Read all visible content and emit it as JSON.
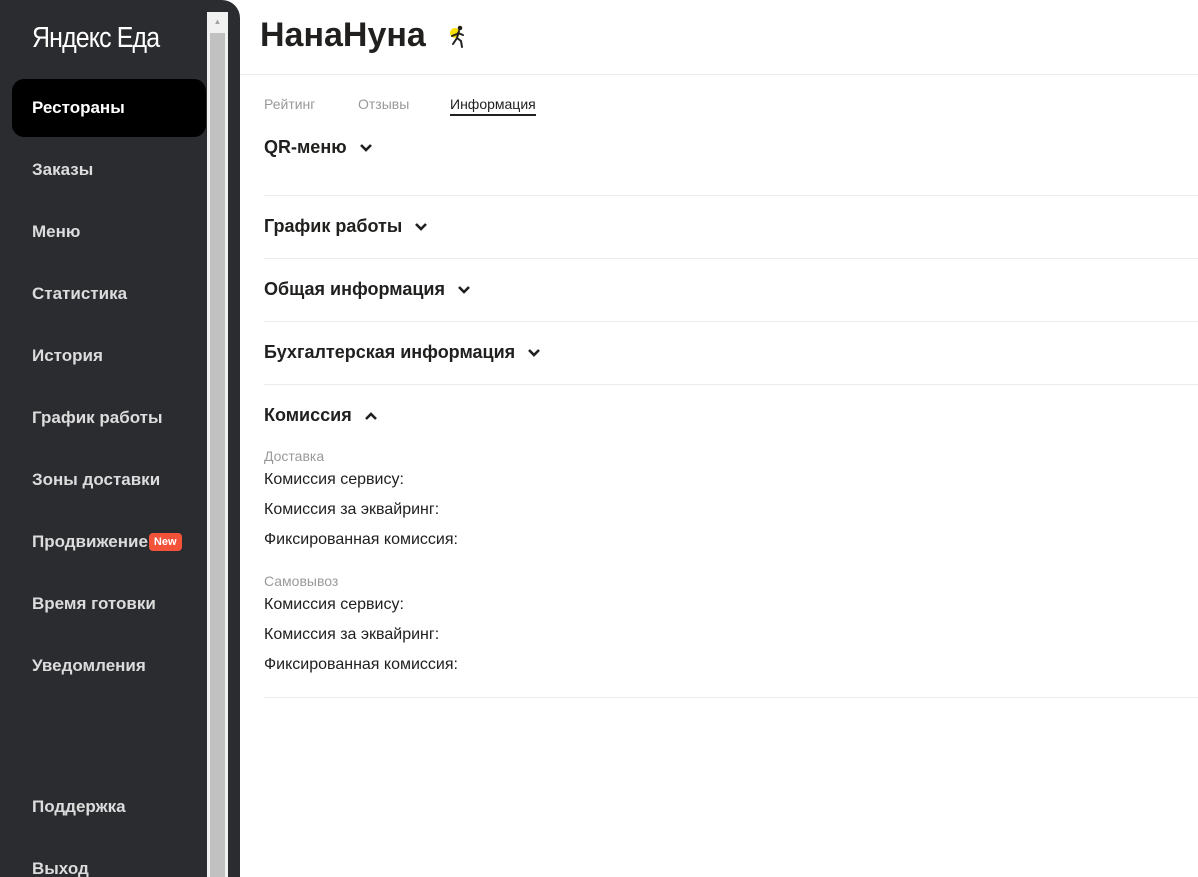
{
  "sidebar": {
    "logo": "Яндекс Еда",
    "items": [
      {
        "label": "Рестораны"
      },
      {
        "label": "Заказы"
      },
      {
        "label": "Меню"
      },
      {
        "label": "Статистика"
      },
      {
        "label": "История"
      },
      {
        "label": "График работы"
      },
      {
        "label": "Зоны доставки"
      },
      {
        "label": "Продвижение",
        "badge": "New"
      },
      {
        "label": "Время готовки"
      },
      {
        "label": "Уведомления"
      }
    ],
    "support": "Поддержка",
    "logout": "Выход"
  },
  "header": {
    "title": "НанаНуна",
    "icon": "courier-icon"
  },
  "tabs": [
    {
      "label": "Рейтинг"
    },
    {
      "label": "Отзывы"
    },
    {
      "label": "Информация",
      "active": true
    }
  ],
  "sections": [
    {
      "title": "QR-меню",
      "expanded": false
    },
    {
      "title": "График работы",
      "expanded": false
    },
    {
      "title": "Общая информация",
      "expanded": false
    },
    {
      "title": "Бухгалтерская информация",
      "expanded": false
    },
    {
      "title": "Комиссия",
      "expanded": true
    }
  ],
  "commission": {
    "delivery": {
      "label": "Доставка",
      "rows": [
        "Комиссия сервису:",
        "Комиссия за эквайринг:",
        "Фиксированная комиссия:"
      ]
    },
    "pickup": {
      "label": "Самовывоз",
      "rows": [
        "Комиссия сервису:",
        "Комиссия за эквайринг:",
        "Фиксированная комиссия:"
      ]
    }
  },
  "colors": {
    "sidebar_bg": "#2b2c30",
    "active_item_bg": "#000000",
    "badge_bg": "#f5523a",
    "brand_yellow": "#fce000"
  }
}
